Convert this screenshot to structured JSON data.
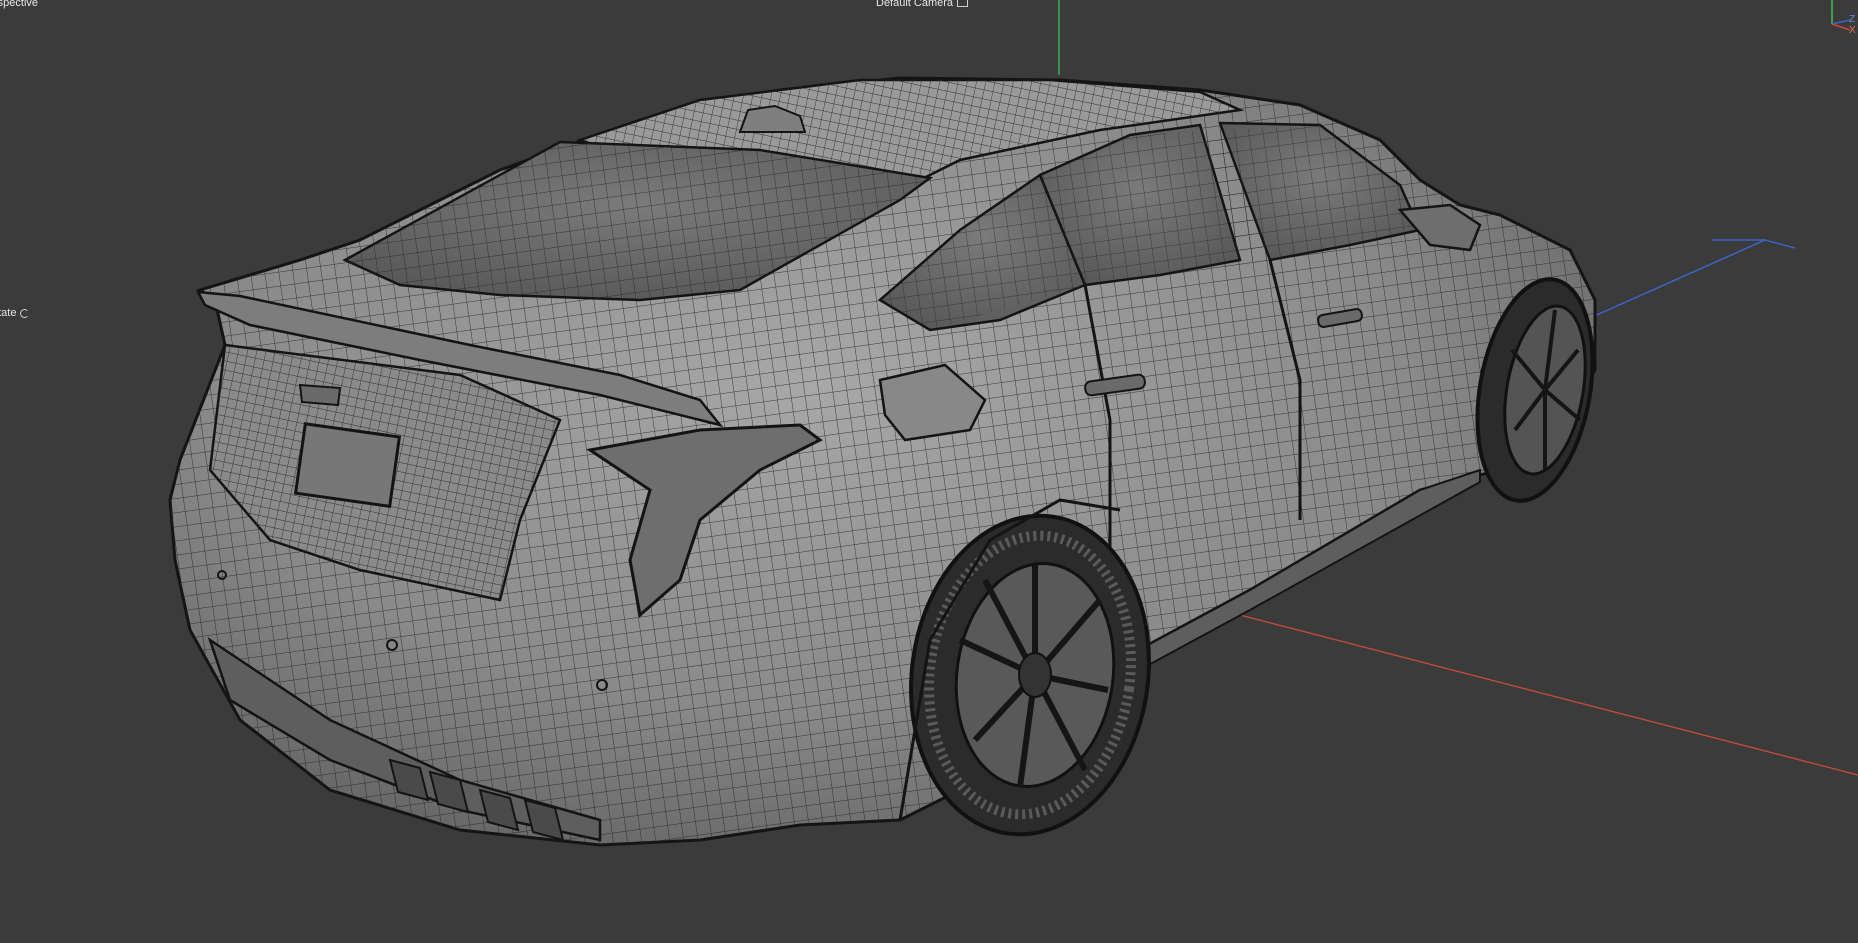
{
  "viewport": {
    "view_label": "rspective",
    "camera_label": "Default Camera",
    "nav_mode_label": "otate",
    "background": "#3b3b3b"
  },
  "axes": {
    "x_color": "#c84a3a",
    "y_color": "#3fbf5a",
    "z_color": "#3a66c8",
    "gizmo_labels": {
      "y": "",
      "z": "Z",
      "x": "X"
    }
  },
  "model": {
    "description_icon": "car-wireframe-icon",
    "body_fill": "#8c8c8c",
    "wire_color": "#1c1c1c"
  },
  "icons": {
    "camera": "camera-icon",
    "orbit": "orbit-icon"
  }
}
